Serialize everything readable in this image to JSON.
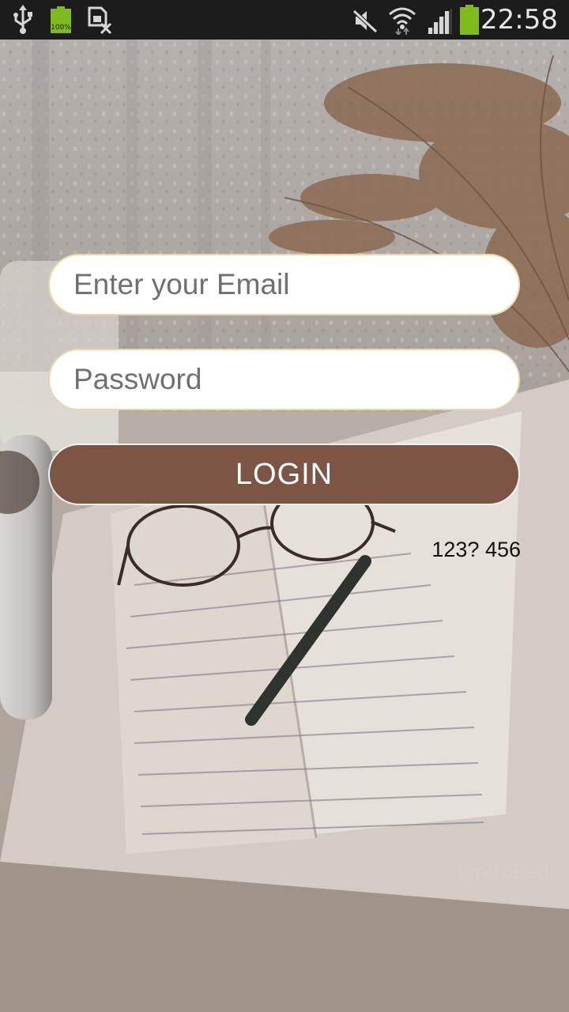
{
  "status_bar": {
    "time": "22:58",
    "battery_label": "100%",
    "icons": [
      "usb-icon",
      "battery-full-icon",
      "sim-card-error-icon",
      "mute-icon",
      "wifi-icon",
      "signal-icon",
      "battery-icon"
    ],
    "battery_color": "#7fbb1c"
  },
  "login_form": {
    "email_placeholder": "Enter your Email",
    "password_placeholder": "Password",
    "login_label": "LOGIN",
    "helper_text": "123? 456",
    "button_color": "#7d5544",
    "field_border_color": "#e8d9a7"
  },
  "background": {
    "watermark": "@relxased"
  }
}
